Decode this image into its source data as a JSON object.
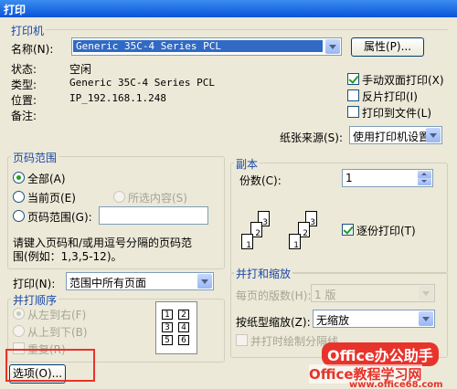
{
  "window": {
    "title": "打印"
  },
  "printer": {
    "section_title": "打印机",
    "name_label": "名称(N):",
    "name_value": "Generic 35C-4 Series PCL",
    "properties_button": "属性(P)...",
    "status_label": "状态:",
    "status_value": "空闲",
    "type_label": "类型:",
    "type_value": "Generic 35C-4 Series PCL",
    "location_label": "位置:",
    "location_value": "IP_192.168.1.248",
    "comment_label": "备注:",
    "manual_duplex": {
      "label": "手动双面打印(X)",
      "checked": true
    },
    "mirror_print": {
      "label": "反片打印(I)",
      "checked": false
    },
    "print_to_file": {
      "label": "打印到文件(L)",
      "checked": false
    },
    "paper_source_label": "纸张来源(S):",
    "paper_source_value": "使用打印机设置"
  },
  "page_range": {
    "section_title": "页码范围",
    "all": "全部(A)",
    "current": "当前页(E)",
    "selection": "所选内容(S)",
    "pages": "页码范围(G):",
    "pages_value": "",
    "hint_line1": "请键入页码和/或用逗号分隔的页码范",
    "hint_line2": "围(例如：1,3,5-12)。"
  },
  "print_what": {
    "label": "打印(N):",
    "value": "范围中所有页面"
  },
  "print_order": {
    "section_title": "并打顺序",
    "left_to_right": "从左到右(F)",
    "top_to_bottom": "从上到下(B)",
    "repeat": "重复(R)",
    "cells": [
      "1",
      "2",
      "3",
      "4",
      "5",
      "6"
    ]
  },
  "copies": {
    "section_title": "副本",
    "count_label": "份数(C):",
    "count_value": "1",
    "collate": {
      "label": "逐份打印(T)",
      "checked": true
    },
    "page_numbers": [
      "1",
      "2",
      "3"
    ]
  },
  "zoom": {
    "section_title": "并打和缩放",
    "pages_per_sheet_label": "每页的版数(H):",
    "pages_per_sheet_value": "1 版",
    "scale_label": "按纸型缩放(Z):",
    "scale_value": "无缩放",
    "draw_borders_label": "并打时绘制分隔线"
  },
  "options_button": "选项(O)...",
  "watermark": {
    "line1": "Office办公助手",
    "line2": "Office教程学习网",
    "url": "www.office68.com"
  },
  "colors": {
    "title_bar": "#0a54d8",
    "group_title": "#1a48a8",
    "highlight": "#316ac5",
    "red_box": "#e8332b",
    "check_green": "#21a121"
  }
}
